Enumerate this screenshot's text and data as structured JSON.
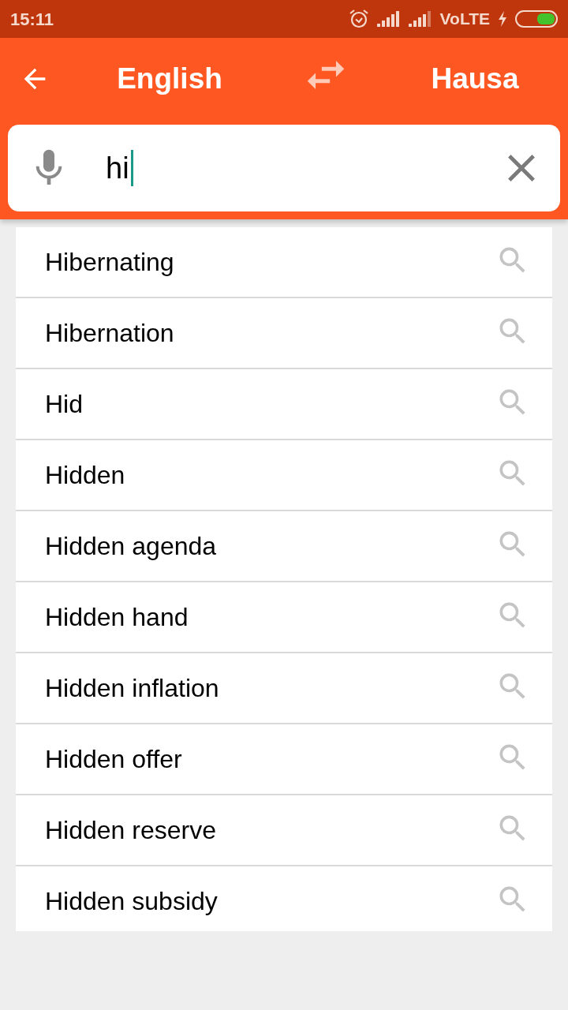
{
  "status_bar": {
    "time": "15:11",
    "network": "VoLTE"
  },
  "header": {
    "source_language": "English",
    "target_language": "Hausa"
  },
  "search": {
    "value": "hi"
  },
  "suggestions": [
    "Hibernating",
    "Hibernation",
    "Hid",
    "Hidden",
    "Hidden agenda",
    "Hidden hand",
    "Hidden inflation",
    "Hidden offer",
    "Hidden reserve",
    "Hidden subsidy"
  ]
}
